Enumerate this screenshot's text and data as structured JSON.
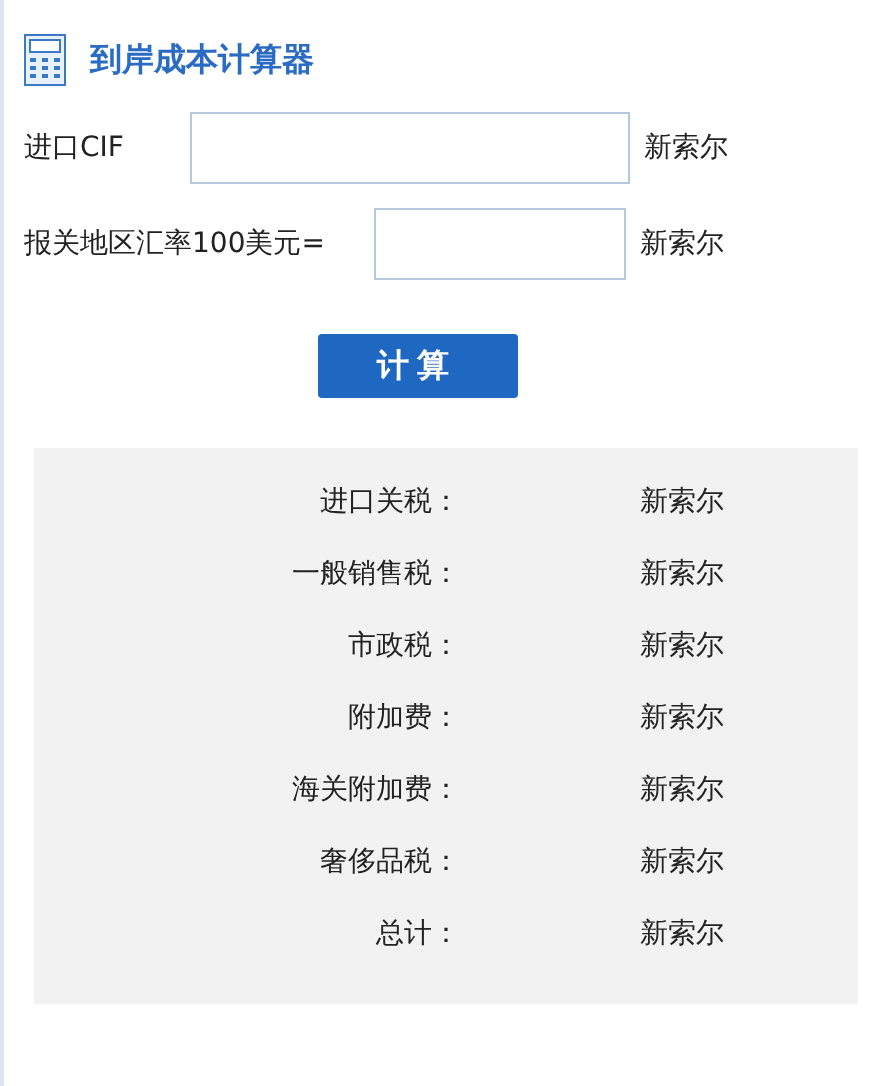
{
  "title": "到岸成本计算器",
  "fields": [
    {
      "label": "进口CIF",
      "unit": "新索尔"
    },
    {
      "label": "报关地区汇率100美元=",
      "unit": "新索尔"
    }
  ],
  "button": "计算",
  "results": [
    {
      "label": "进口关税：",
      "value": "新索尔"
    },
    {
      "label": "一般销售税：",
      "value": "新索尔"
    },
    {
      "label": "市政税：",
      "value": "新索尔"
    },
    {
      "label": "附加费：",
      "value": "新索尔"
    },
    {
      "label": "海关附加费：",
      "value": "新索尔"
    },
    {
      "label": "奢侈品税：",
      "value": "新索尔"
    },
    {
      "label": "总计：",
      "value": "新索尔"
    }
  ]
}
